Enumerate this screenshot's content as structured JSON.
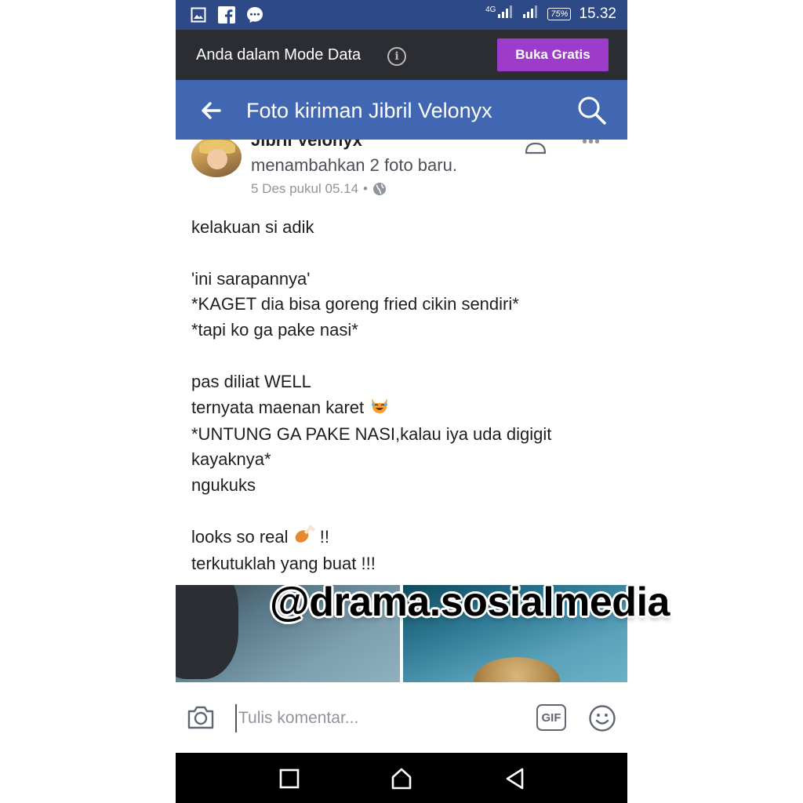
{
  "status_bar": {
    "network": "4G",
    "battery": "75%",
    "time": "15.32",
    "icons": [
      "image-icon",
      "facebook-icon",
      "messenger-icon",
      "signal-icon",
      "battery-icon"
    ]
  },
  "data_mode_bar": {
    "text": "Anda dalam Mode Data",
    "info_icon": "i",
    "button_label": "Buka Gratis",
    "button_color": "#9d3ccb"
  },
  "header": {
    "title": "Foto kiriman Jibril Velonyx",
    "color": "#4267b2"
  },
  "post": {
    "author": "Jibril Velonyx",
    "action": "menambahkan 2 foto baru.",
    "date": "5 Des pukul 05.14",
    "separator": "•",
    "paragraphs": [
      [
        "kelakuan si adik"
      ],
      [
        "'ini sarapannya'",
        "*KAGET dia bisa goreng fried cikin sendiri*",
        "*tapi ko ga pake nasi*"
      ],
      [
        "pas diliat WELL",
        "ternyata maenan karet",
        "*UNTUNG GA PAKE NASI,kalau iya uda digigit",
        "kayaknya*",
        "ngukuks"
      ],
      [
        "looks so real",
        "terkutuklah yang buat !!!"
      ]
    ],
    "emoji_cat": "cat-laughing-emoji",
    "emoji_chicken": "chicken-leg-emoji",
    "exclaim": "!!"
  },
  "watermark": "@drama.sosialmedia",
  "comment_bar": {
    "placeholder": "Tulis komentar...",
    "gif_label": "GIF"
  },
  "nav_bar": {
    "buttons": [
      "recent-apps",
      "home",
      "back"
    ]
  }
}
